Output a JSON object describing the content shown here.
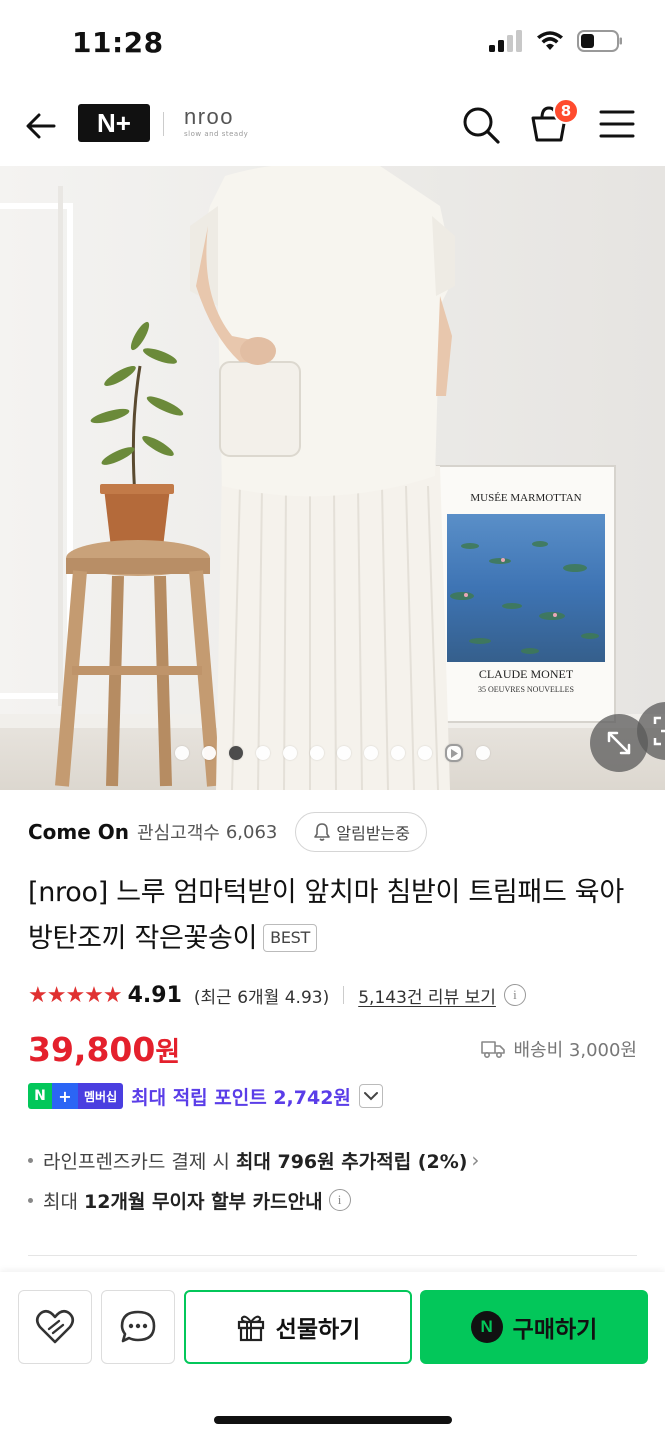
{
  "status_bar": {
    "time": "11:28"
  },
  "header": {
    "logo_text": "N+",
    "store_name": "nroo",
    "store_tagline": "slow and steady",
    "cart_count": "8"
  },
  "gallery": {
    "dot_count": 12,
    "active_index": 2,
    "play_index": 10,
    "poster_title": "MUSÉE MARMOTTAN",
    "poster_artist": "CLAUDE MONET",
    "poster_sub": "35 OEUVRES NOUVELLES"
  },
  "store": {
    "name": "Come On",
    "interest_label": "관심고객수",
    "interest_count": "6,063",
    "alert_label": "알림받는중"
  },
  "product": {
    "title": "[nroo] 느루 엄마턱받이 앞치마 침받이 트림패드 육아방탄조끼 작은꽃송이",
    "badge": "BEST"
  },
  "rating": {
    "stars": "★★★★★",
    "value": "4.91",
    "recent": "(최근 6개월 4.93)",
    "review_link": "5,143건 리뷰 보기"
  },
  "price": {
    "amount": "39,800",
    "unit": "원",
    "shipping": "배송비 3,000원"
  },
  "membership": {
    "badge_n": "N",
    "badge_plus": "+",
    "badge_text": "멤버십",
    "point_text": "최대 적립 포인트 2,742원"
  },
  "benefits": {
    "card_prefix": "라인프렌즈카드 결제 시 ",
    "card_bold": "최대 796원 추가적립 (2%)",
    "install_prefix": "최대 ",
    "install_bold": "12개월 무이자 할부 카드안내"
  },
  "actions": {
    "gift_label": "선물하기",
    "buy_label": "구매하기",
    "buy_icon": "N"
  },
  "colors": {
    "naver_green": "#03c75a",
    "price_red": "#e4202c",
    "membership_purple": "#5a3de8",
    "star_red": "#e03131",
    "cart_badge": "#ff4b2e"
  }
}
